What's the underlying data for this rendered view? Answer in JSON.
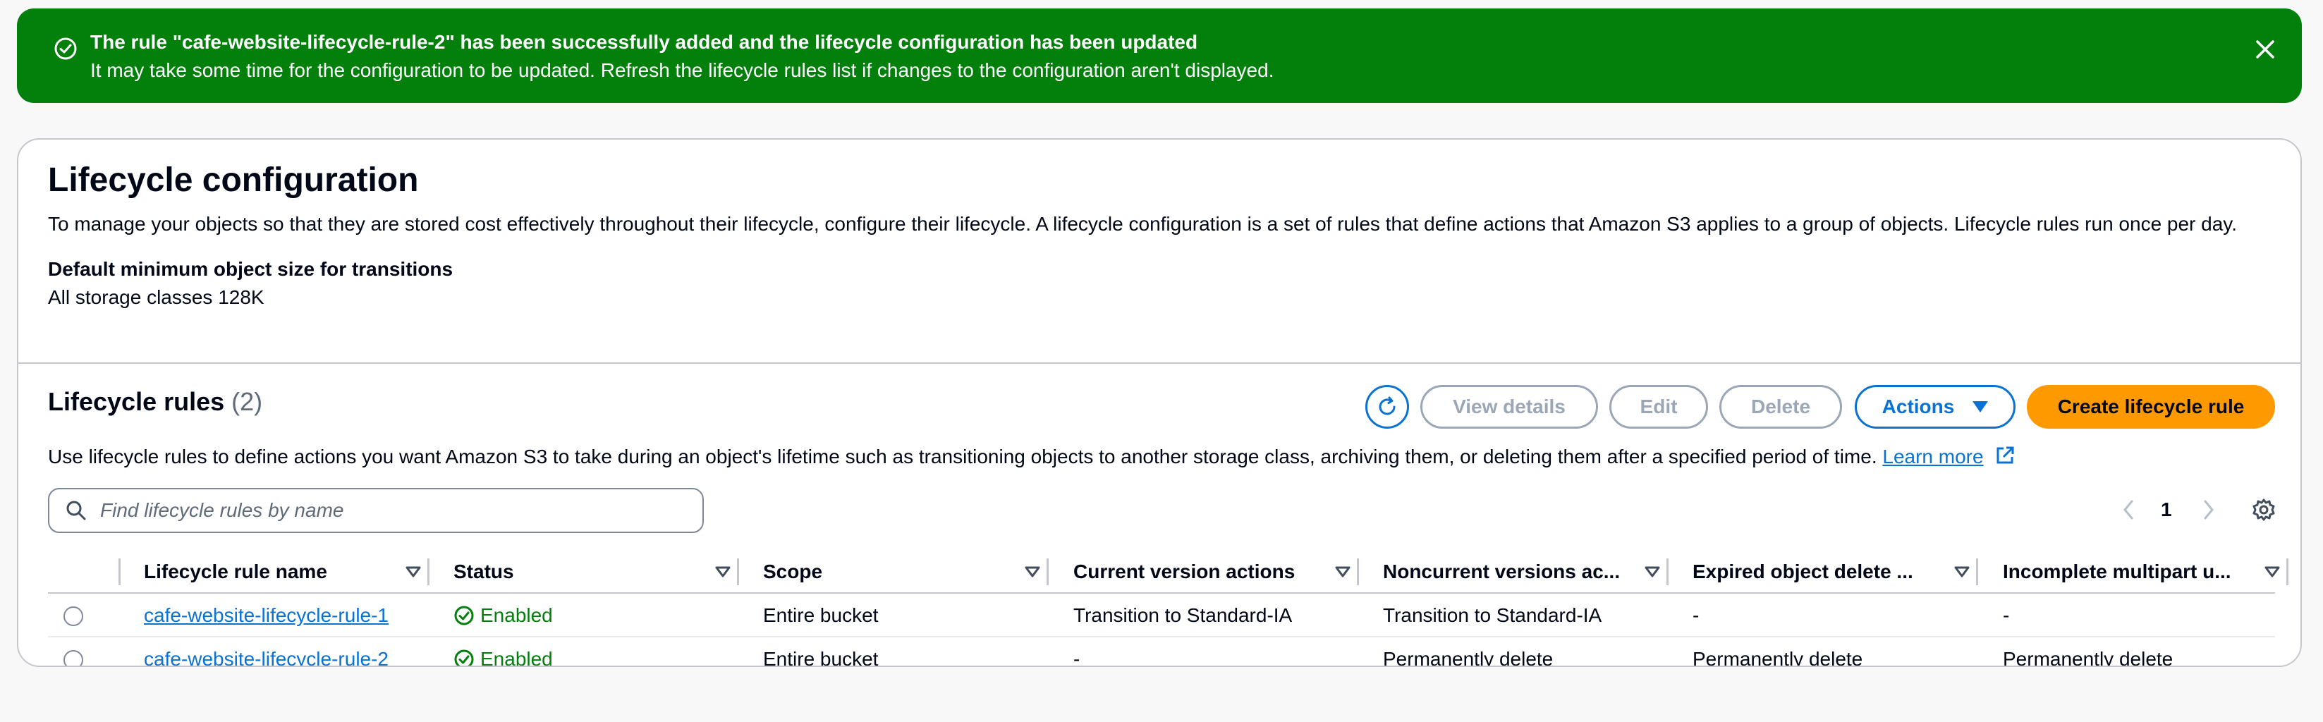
{
  "flash": {
    "title": "The rule \"cafe-website-lifecycle-rule-2\" has been successfully added and the lifecycle configuration has been updated",
    "message": "It may take some time for the configuration to be updated. Refresh the lifecycle rules list if changes to the configuration aren't displayed.",
    "color": "#037f0c"
  },
  "config": {
    "title": "Lifecycle configuration",
    "description": "To manage your objects so that they are stored cost effectively throughout their lifecycle, configure their lifecycle. A lifecycle configuration is a set of rules that define actions that Amazon S3 applies to a group of objects. Lifecycle rules run once per day.",
    "min_size_label": "Default minimum object size for transitions",
    "min_size_value": "All storage classes 128K"
  },
  "rules": {
    "title": "Lifecycle rules",
    "count": "(2)",
    "description": "Use lifecycle rules to define actions you want Amazon S3 to take during an object's lifetime such as transitioning objects to another storage class, archiving them, or deleting them after a specified period of time.",
    "learn_more": "Learn more",
    "buttons": {
      "view_details": "View details",
      "edit": "Edit",
      "delete": "Delete",
      "actions": "Actions",
      "create": "Create lifecycle rule"
    },
    "search_placeholder": "Find lifecycle rules by name",
    "page": "1",
    "columns": [
      "Lifecycle rule name",
      "Status",
      "Scope",
      "Current version actions",
      "Noncurrent versions ac...",
      "Expired object delete ...",
      "Incomplete multipart u..."
    ],
    "rows": [
      {
        "name": "cafe-website-lifecycle-rule-1",
        "status": "Enabled",
        "scope": "Entire bucket",
        "current": "Transition to Standard-IA",
        "noncurrent": "Transition to Standard-IA",
        "expired": "-",
        "incomplete": "-"
      },
      {
        "name": "cafe-website-lifecycle-rule-2",
        "status": "Enabled",
        "scope": "Entire bucket",
        "current": "-",
        "noncurrent": "Permanently delete",
        "expired": "Permanently delete",
        "incomplete": "Permanently delete"
      }
    ]
  },
  "colors": {
    "accent": "#0972d3",
    "primary_button": "#ff9900",
    "success": "#037f0c"
  },
  "icons": [
    "success-icon",
    "close-icon",
    "refresh-icon",
    "caret-down-icon",
    "external-link-icon",
    "search-icon",
    "chevron-left-icon",
    "chevron-right-icon",
    "gear-icon",
    "sort-icon",
    "status-check-icon"
  ]
}
